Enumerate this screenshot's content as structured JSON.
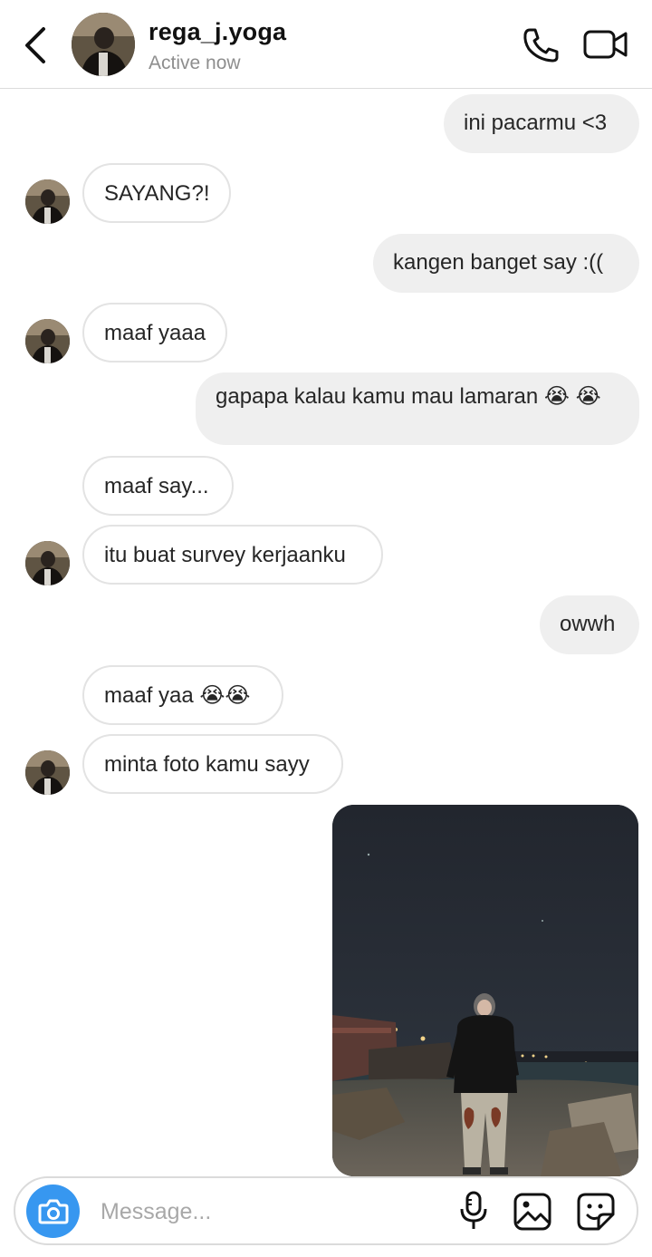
{
  "header": {
    "username": "rega_j.yoga",
    "status": "Active now"
  },
  "messages": [
    {
      "from": "me",
      "text": "ini pacarmu <3"
    },
    {
      "from": "them",
      "text": "SAYANG?!"
    },
    {
      "from": "me",
      "text": "kangen banget say :(("
    },
    {
      "from": "them",
      "text": "maaf yaaa"
    },
    {
      "from": "me",
      "text": "gapapa kalau kamu mau lamaran 😭 😭"
    },
    {
      "from": "them",
      "text": "maaf say..."
    },
    {
      "from": "them",
      "text": "itu buat survey kerjaanku"
    },
    {
      "from": "me",
      "text": "owwh"
    },
    {
      "from": "them",
      "text": "maaf yaa 😭😭"
    },
    {
      "from": "them",
      "text": "minta foto kamu sayy"
    },
    {
      "from": "me",
      "type": "photo"
    }
  ],
  "composer": {
    "placeholder": "Message..."
  },
  "colors": {
    "accent": "#3797f0",
    "incoming_border": "#e3e3e3",
    "outgoing_bg": "#efefef"
  },
  "icons": [
    "back-arrow-icon",
    "phone-icon",
    "video-camera-icon",
    "camera-icon",
    "microphone-icon",
    "gallery-icon",
    "sticker-icon"
  ]
}
